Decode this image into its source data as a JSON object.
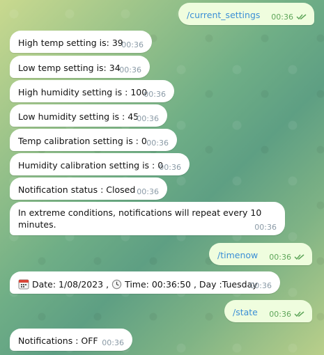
{
  "messages": [
    {
      "id": "cmd-current-settings",
      "direction": "out",
      "text": "/current_settings",
      "time": "00:36"
    },
    {
      "id": "high-temp",
      "direction": "in",
      "text": "High temp setting is: 39",
      "time": "00:36"
    },
    {
      "id": "low-temp",
      "direction": "in",
      "text": "Low temp setting is: 34",
      "time": "00:36"
    },
    {
      "id": "high-humidity",
      "direction": "in",
      "text": "High humidity setting is : 100",
      "time": "00:36"
    },
    {
      "id": "low-humidity",
      "direction": "in",
      "text": "Low humidity setting is : 45",
      "time": "00:36"
    },
    {
      "id": "temp-calibration",
      "direction": "in",
      "text": "Temp calibration setting is : 0",
      "time": "00:36"
    },
    {
      "id": "humidity-calibration",
      "direction": "in",
      "text": "Humidity calibration setting is : 0",
      "time": "00:36"
    },
    {
      "id": "notification-status",
      "direction": "in",
      "text": "Notification status : Closed",
      "time": "00:36"
    },
    {
      "id": "extreme-conditions",
      "direction": "in",
      "text": "In extreme conditions, notifications will repeat every 10 minutes.",
      "time": "00:36"
    },
    {
      "id": "cmd-timenow",
      "direction": "out",
      "text": "/timenow",
      "time": "00:36"
    },
    {
      "id": "date-time",
      "direction": "in",
      "date_text": "Date:  1/08/2023 ,",
      "time_text": "Time: 00:36:50 , Day :Tuesday",
      "time": "00:36"
    },
    {
      "id": "cmd-state",
      "direction": "out",
      "text": "/state",
      "time": "00:36"
    },
    {
      "id": "notifications-off",
      "direction": "in",
      "text": "Notifications : OFF",
      "time": "00:36"
    }
  ],
  "icons": {
    "calendar": "calendar-icon",
    "clock": "clock-icon",
    "read_receipt": "double-check-icon"
  },
  "colors": {
    "incoming_bubble": "#ffffff",
    "outgoing_bubble": "#effdde",
    "outgoing_text": "#3b8fd6",
    "outgoing_time": "#5fa65a",
    "incoming_time": "#8a9aa6"
  }
}
